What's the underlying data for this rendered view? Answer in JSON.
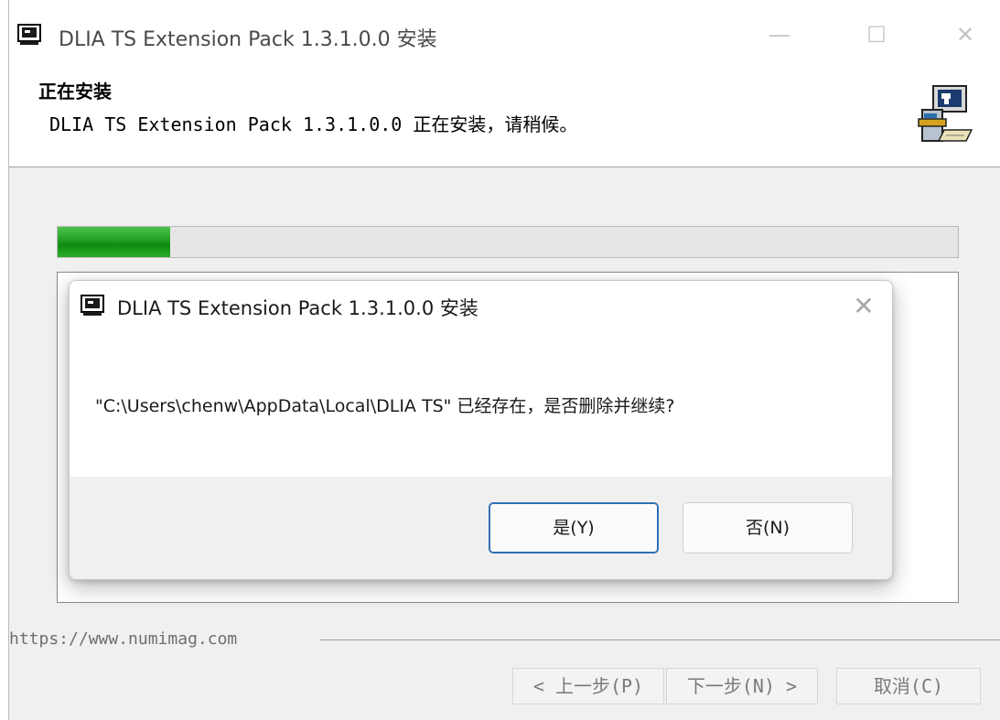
{
  "window": {
    "title": "DLIA TS Extension Pack 1.3.1.0.0 安装",
    "minimize_glyph": "—",
    "maximize_glyph": "☐",
    "close_glyph": "✕",
    "icon": "installer-app-icon"
  },
  "header": {
    "title": "正在安装",
    "subtitle": "DLIA TS Extension Pack 1.3.1.0.0 正在安装，请稍候。",
    "icon": "installer-computer-icon"
  },
  "progress": {
    "fraction": 0.125,
    "fill_color": "#1f9e1f"
  },
  "dialog": {
    "title": "DLIA TS Extension Pack 1.3.1.0.0 安装",
    "close_glyph": "✕",
    "message": "\"C:\\Users\\chenw\\AppData\\Local\\DLIA TS\" 已经存在，是否删除并继续?",
    "yes_label": "是(Y)",
    "no_label": "否(N)",
    "accent_color": "#2f6fb5"
  },
  "footer": {
    "brand": "https://www.numimag.com",
    "prev_label": "< 上一步(P)",
    "next_label": "下一步(N) >",
    "cancel_label": "取消(C)"
  }
}
